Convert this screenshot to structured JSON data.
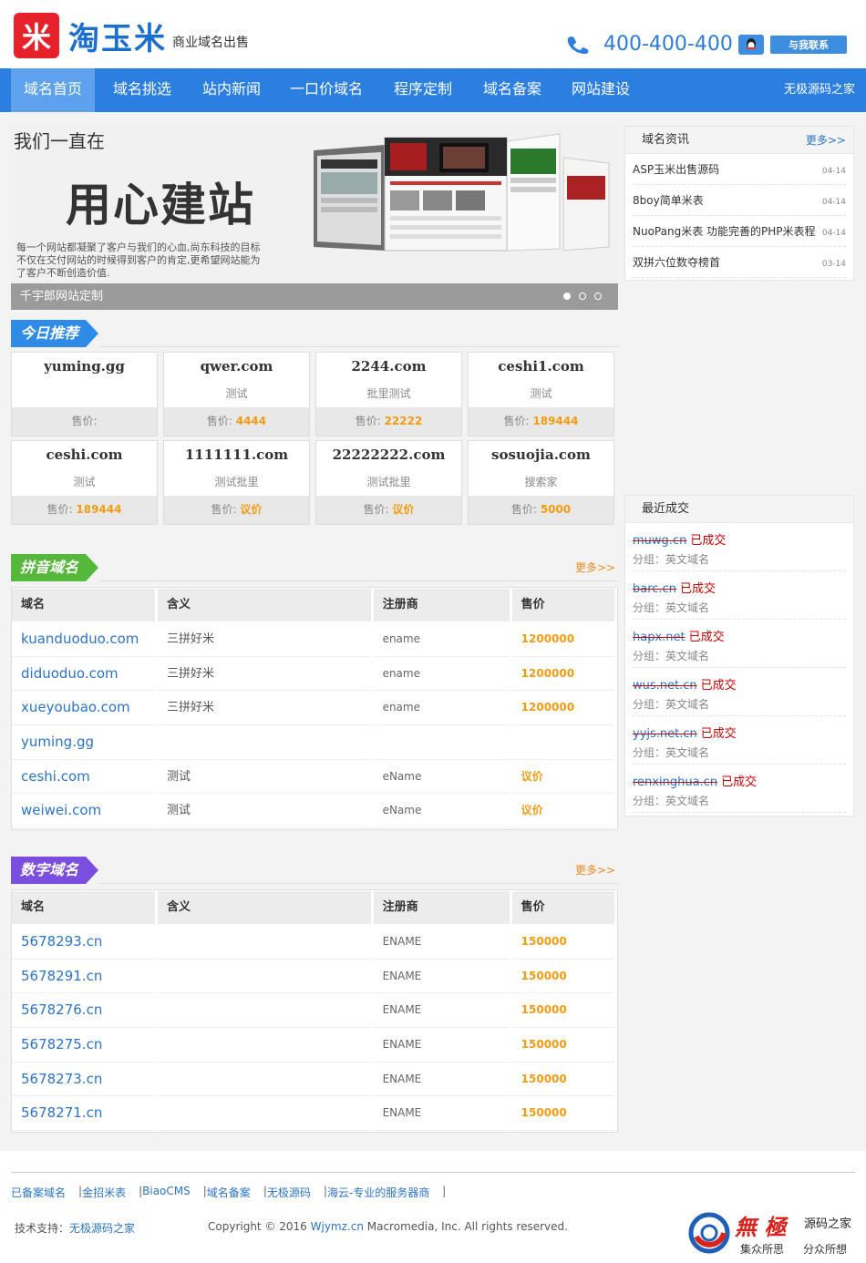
{
  "header": {
    "logo_mark": "米",
    "logo_name": "淘玉米",
    "logo_sub": "商业域名出售",
    "phone": "400-400-400",
    "contact_label": "与我联系"
  },
  "nav": {
    "items": [
      "域名首页",
      "域名挑选",
      "站内新闻",
      "一口价域名",
      "程序定制",
      "域名备案",
      "网站建设"
    ],
    "right": "无极源码之家"
  },
  "banner": {
    "title1": "我们一直在",
    "title2": "用心建站",
    "desc": "每一个网站都凝聚了客户与我们的心血,尚东科技的目标不仅在交付网站的时候得到客户的肯定,更希望网站能为了客户不断创造价值.",
    "caption": "千宇郎网站定制"
  },
  "recommend": {
    "title": "今日推荐",
    "price_label": "售价:",
    "cards": [
      {
        "domain": "yuming.gg",
        "desc": "",
        "price": ""
      },
      {
        "domain": "qwer.com",
        "desc": "测试",
        "price": "4444"
      },
      {
        "domain": "2244.com",
        "desc": "批里测试",
        "price": "22222"
      },
      {
        "domain": "ceshi1.com",
        "desc": "测试",
        "price": "189444"
      },
      {
        "domain": "ceshi.com",
        "desc": "测试",
        "price": "189444"
      },
      {
        "domain": "1111111.com",
        "desc": "测试批里",
        "price": "议价"
      },
      {
        "domain": "22222222.com",
        "desc": "测试批里",
        "price": "议价"
      },
      {
        "domain": "sosuojia.com",
        "desc": "搜索家",
        "price": "5000"
      }
    ]
  },
  "pinyin": {
    "title": "拼音域名",
    "more": "更多>>",
    "headers": [
      "域名",
      "含义",
      "注册商",
      "售价"
    ],
    "rows": [
      {
        "domain": "kuanduoduo.com",
        "meaning": "三拼好米",
        "registrar": "ename",
        "price": "1200000"
      },
      {
        "domain": "diduoduo.com",
        "meaning": "三拼好米",
        "registrar": "ename",
        "price": "1200000"
      },
      {
        "domain": "xueyoubao.com",
        "meaning": "三拼好米",
        "registrar": "ename",
        "price": "1200000"
      },
      {
        "domain": "yuming.gg",
        "meaning": "",
        "registrar": "",
        "price": ""
      },
      {
        "domain": "ceshi.com",
        "meaning": "测试",
        "registrar": "eName",
        "price": "议价"
      },
      {
        "domain": "weiwei.com",
        "meaning": "测试",
        "registrar": "eName",
        "price": "议价"
      }
    ]
  },
  "numeric": {
    "title": "数字域名",
    "more": "更多>>",
    "headers": [
      "域名",
      "含义",
      "注册商",
      "售价"
    ],
    "rows": [
      {
        "domain": "5678293.cn",
        "meaning": "",
        "registrar": "ENAME",
        "price": "150000"
      },
      {
        "domain": "5678291.cn",
        "meaning": "",
        "registrar": "ENAME",
        "price": "150000"
      },
      {
        "domain": "5678276.cn",
        "meaning": "",
        "registrar": "ENAME",
        "price": "150000"
      },
      {
        "domain": "5678275.cn",
        "meaning": "",
        "registrar": "ENAME",
        "price": "150000"
      },
      {
        "domain": "5678273.cn",
        "meaning": "",
        "registrar": "ENAME",
        "price": "150000"
      },
      {
        "domain": "5678271.cn",
        "meaning": "",
        "registrar": "ENAME",
        "price": "150000"
      }
    ]
  },
  "news": {
    "title": "域名资讯",
    "more": "更多>>",
    "items": [
      {
        "title": "ASP玉米出售源码",
        "date": "04-14"
      },
      {
        "title": "8boy简单米表",
        "date": "04-14"
      },
      {
        "title": "NuoPang米表 功能完善的PHP米表程",
        "date": "04-14"
      },
      {
        "title": "双拼六位数夺榜首",
        "date": "03-14"
      }
    ]
  },
  "deals": {
    "title": "最近成交",
    "status": "已成交",
    "group_label": "分组：英文域名",
    "items": [
      "muwg.cn",
      "barc.cn",
      "hapx.net",
      "wus.net.cn",
      "yyjs.net.cn",
      "renxinghua.cn"
    ]
  },
  "footer": {
    "links": [
      "已备案域名",
      "金招米表",
      "BiaoCMS",
      "域名备案",
      "无极源码",
      "海云-专业的服务器商"
    ],
    "sep": "|",
    "support_label": "技术支持：",
    "support_name": "无极源码之家",
    "copy_pre": "Copyright © 2016 ",
    "copy_site": "Wjymz.cn",
    "copy_post": " Macromedia, Inc. All rights reserved.",
    "logo_text": "源码之家",
    "logo_slogan1": "集众所思",
    "logo_slogan2": "分众所想",
    "logo_big": "無 極"
  },
  "colors": {
    "nav": "#2b7fe0",
    "recommend_tag": "#2e8be6",
    "pinyin_tag": "#55b83a",
    "numeric_tag": "#7c4ee0",
    "price": "#f39c12"
  }
}
